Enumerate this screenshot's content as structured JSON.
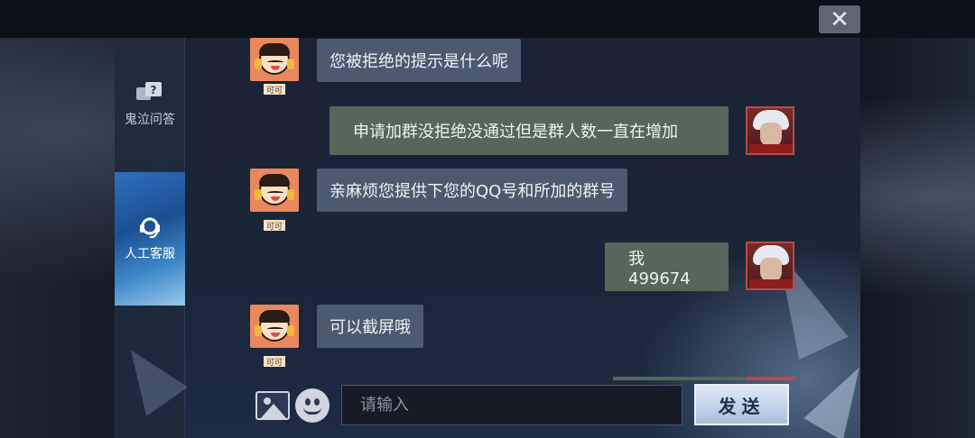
{
  "window": {
    "close_symbol": "✕"
  },
  "sidebar": {
    "items": [
      {
        "label": "鬼泣问答",
        "icon": "question-chat-icon",
        "active": false
      },
      {
        "label": "人工客服",
        "icon": "headset-icon",
        "active": true
      }
    ]
  },
  "chat": {
    "agent_name": "可可",
    "messages": [
      {
        "from": "agent",
        "text": "您被拒绝的提示是什么呢"
      },
      {
        "from": "user",
        "text": "申请加群没拒绝没通过但是群人数一直在增加"
      },
      {
        "from": "agent",
        "text": "亲麻烦您提供下您的QQ号和所加的群号"
      },
      {
        "from": "user",
        "text": "我499674"
      },
      {
        "from": "agent",
        "text": "可以截屏哦"
      }
    ]
  },
  "input_bar": {
    "placeholder": "请输入",
    "value": "",
    "send_label": "发送",
    "image_icon": "image-icon",
    "emoji_icon": "emoji-icon"
  },
  "colors": {
    "agent_bubble": "#4b5a6d",
    "user_bubble": "#54675a",
    "active_tab": "#2e6fbd"
  }
}
